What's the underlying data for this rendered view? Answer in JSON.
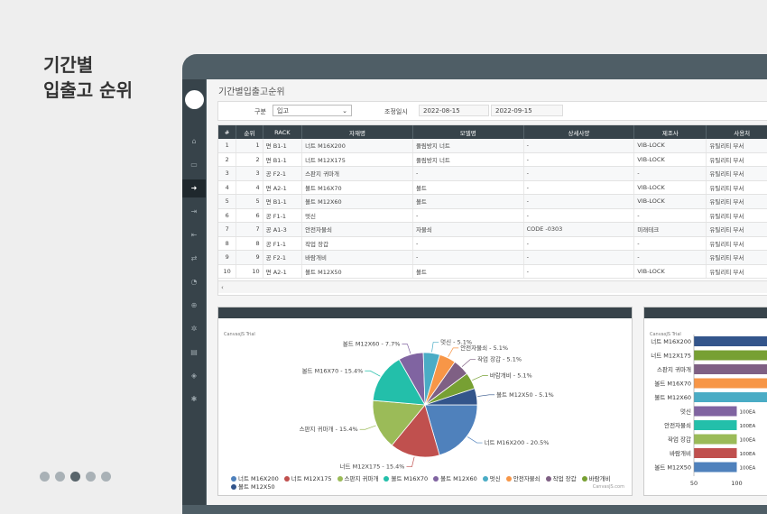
{
  "hero": {
    "line1": "기간별",
    "line2": "입출고 순위"
  },
  "page": {
    "title": "기간별입출고순위"
  },
  "filter": {
    "category_label": "구분",
    "category_value": "입고",
    "period_label": "조정일시",
    "date_from": "2022-08-15",
    "date_to": "2022-09-15"
  },
  "sidebar": {
    "icons": [
      "home-icon",
      "inbox-icon",
      "sign-in-icon",
      "sign-out-icon",
      "sign-out-alt-icon",
      "exchange-icon",
      "pie-chart-icon",
      "search-plus-icon",
      "cogs-icon",
      "file-icon",
      "dropbox-icon",
      "gear-icon"
    ],
    "active_index": 2
  },
  "table": {
    "columns": [
      "#",
      "순위",
      "RACK",
      "자재명",
      "모델명",
      "상세사양",
      "제조사",
      "사용처"
    ],
    "rows": [
      [
        "1",
        "1",
        "면 B1-1",
        "너트 M16X200",
        "풀림방지 너트",
        "-",
        "VIB-LOCK",
        "유틸리티 부서"
      ],
      [
        "2",
        "2",
        "면 B1-1",
        "너트 M12X175",
        "풀림방지 너트",
        "-",
        "VIB-LOCK",
        "유틸리티 부서"
      ],
      [
        "3",
        "3",
        "공 F2-1",
        "스판지 귀마개",
        "-",
        "-",
        "-",
        "유틸리티 부서"
      ],
      [
        "4",
        "4",
        "면 A2-1",
        "볼트 M16X70",
        "볼트",
        "-",
        "VIB-LOCK",
        "유틸리티 부서"
      ],
      [
        "5",
        "5",
        "면 B1-1",
        "볼트 M12X60",
        "볼트",
        "-",
        "VIB-LOCK",
        "유틸리티 부서"
      ],
      [
        "6",
        "6",
        "공 F1-1",
        "멋신",
        "-",
        "-",
        "-",
        "유틸리티 부서"
      ],
      [
        "7",
        "7",
        "공 A1-3",
        "안전자물쇠",
        "자물쇠",
        "CODE -0303",
        "미래테크",
        "유틸리티 부서"
      ],
      [
        "8",
        "8",
        "공 F1-1",
        "작업 장갑",
        "-",
        "-",
        "-",
        "유틸리티 부서"
      ],
      [
        "9",
        "9",
        "공 F2-1",
        "바람개비",
        "-",
        "-",
        "-",
        "유틸리티 부서"
      ],
      [
        "10",
        "10",
        "면 A2-1",
        "볼트 M12X50",
        "볼트",
        "-",
        "VIB-LOCK",
        "유틸리티 부서"
      ]
    ],
    "scroll_arrow": "‹"
  },
  "pie_panel": {
    "trial_text": "CanvasJS Trial",
    "credit_text": "CanvasJS.com"
  },
  "bar_panel": {
    "trial_text": "CanvasJS Trial"
  },
  "colors": {
    "sidebar": "#37434a",
    "device": "#4f5e66",
    "header": "#37434a"
  },
  "chart_data": [
    {
      "type": "pie",
      "labels": [
        "너트 M16X200",
        "너트 M12X175",
        "스판지 귀마개",
        "볼트 M16X70",
        "볼트 M12X60",
        "멋신",
        "안전자물쇠",
        "작업 장갑",
        "바람개비",
        "볼트 M12X50"
      ],
      "values": [
        20.5,
        15.4,
        15.4,
        15.4,
        7.7,
        5.1,
        5.1,
        5.1,
        5.1,
        5.1
      ],
      "slice_labels": [
        "너트 M16X200 - 20.5%",
        "너트 M12X175 - 15.4%",
        "스판지 귀마개 - 15.4%",
        "볼트 M16X70 - 15.4%",
        "볼트 M12X60 - 7.7%",
        "멋신 - 5.1%",
        "안전자물쇠 - 5.1%",
        "작업 장갑 - 5.1%",
        "바람개비 - 5.1%",
        "볼트 M12X50 - 5.1%"
      ],
      "colors": [
        "#4f81bc",
        "#c0504e",
        "#9bbb58",
        "#23bfaa",
        "#8064a1",
        "#4aacc5",
        "#f79647",
        "#7f6084",
        "#77a033",
        "#33558b"
      ],
      "legend": "bottom"
    },
    {
      "type": "bar",
      "orientation": "horizontal",
      "categories": [
        "너트 M16X200",
        "너트 M12X175",
        "스판지 귀마개",
        "볼트 M16X70",
        "볼트 M12X60",
        "멋신",
        "안전자물쇠",
        "작업 장갑",
        "바람개비",
        "볼트 M12X50"
      ],
      "values": [
        400,
        300,
        300,
        300,
        150,
        100,
        100,
        100,
        100,
        100
      ],
      "data_labels": [
        "",
        "",
        "",
        "",
        "",
        "100EA",
        "100EA",
        "100EA",
        "100EA",
        "100EA"
      ],
      "colors": [
        "#33558b",
        "#77a033",
        "#7f6084",
        "#f79647",
        "#4aacc5",
        "#8064a1",
        "#23bfaa",
        "#9bbb58",
        "#c0504e",
        "#4f81bc"
      ],
      "x_ticks": [
        "50",
        "100"
      ],
      "xlim": [
        50,
        150
      ]
    }
  ]
}
